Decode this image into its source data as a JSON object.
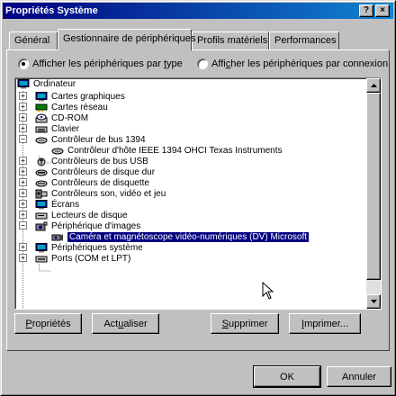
{
  "window": {
    "title": "Propriétés Système"
  },
  "titlebar_buttons": {
    "help": "?",
    "close": "×"
  },
  "tabs": [
    {
      "label": "Général"
    },
    {
      "label": "Gestionnaire de périphériques"
    },
    {
      "label": "Profils matériels"
    },
    {
      "label": "Performances"
    }
  ],
  "view_options": {
    "by_type": {
      "before": "Afficher les périphériques par ",
      "accel": "t",
      "after": "ype"
    },
    "by_connection": {
      "before": "Affi",
      "accel": "c",
      "after": "her les périphériques par connexion"
    }
  },
  "tree": {
    "root": "Ordinateur",
    "items": [
      {
        "label": "Cartes graphiques",
        "icon": "display-adapter-icon",
        "exp": "+"
      },
      {
        "label": "Cartes réseau",
        "icon": "network-card-icon",
        "exp": "+"
      },
      {
        "label": "CD-ROM",
        "icon": "cdrom-icon",
        "exp": "+"
      },
      {
        "label": "Clavier",
        "icon": "keyboard-icon",
        "exp": "+"
      },
      {
        "label": "Contrôleur de bus 1394",
        "icon": "bus-controller-icon",
        "exp": "−"
      },
      {
        "label": "Contrôleur d'hôte IEEE 1394 OHCI Texas Instruments",
        "icon": "bus-controller-icon",
        "child": true
      },
      {
        "label": "Contrôleurs de bus USB",
        "icon": "usb-icon",
        "exp": "+"
      },
      {
        "label": "Contrôleurs de disque dur",
        "icon": "hard-disk-controller-icon",
        "exp": "+"
      },
      {
        "label": "Contrôleurs de disquette",
        "icon": "floppy-controller-icon",
        "exp": "+"
      },
      {
        "label": "Contrôleurs son, vidéo et jeu",
        "icon": "sound-icon",
        "exp": "+"
      },
      {
        "label": "Écrans",
        "icon": "monitor-icon",
        "exp": "+"
      },
      {
        "label": "Lecteurs de disque",
        "icon": "disk-drive-icon",
        "exp": "+"
      },
      {
        "label": "Périphérique d'images",
        "icon": "imaging-device-icon",
        "exp": "−"
      },
      {
        "label": "Caméra et magnétoscope vidéo-numériques (DV) Microsoft",
        "icon": "camera-icon",
        "child": true,
        "selected": true
      },
      {
        "label": "Périphériques système",
        "icon": "system-device-icon",
        "exp": "+"
      },
      {
        "label": "Ports (COM et LPT)",
        "icon": "port-icon",
        "exp": "+"
      }
    ]
  },
  "actions": {
    "properties": {
      "accel": "P",
      "rest": "ropriétés"
    },
    "refresh": {
      "before": "Act",
      "accel": "u",
      "after": "aliser"
    },
    "remove": {
      "accel": "S",
      "rest": "upprimer"
    },
    "print": {
      "accel": "I",
      "rest": "mprimer..."
    }
  },
  "dialog": {
    "ok": "OK",
    "cancel": "Annuler"
  }
}
